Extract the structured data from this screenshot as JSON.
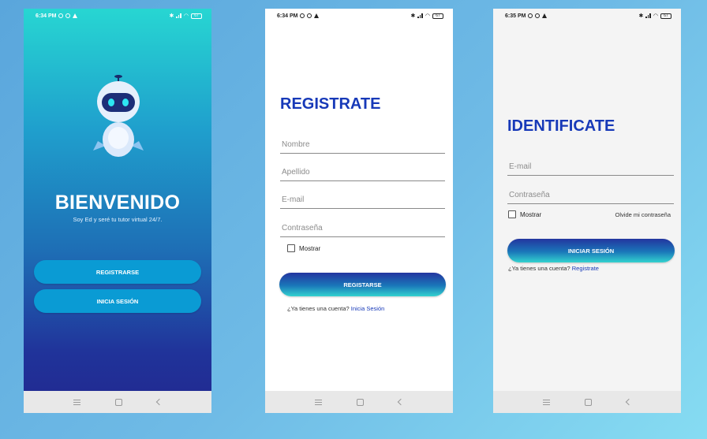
{
  "screens": {
    "welcome": {
      "status_time": "6:34 PM",
      "battery": "67",
      "title": "BIENVENIDO",
      "subtitle": "Soy Ed y seré tu tutor virtual 24/7.",
      "register_button": "REGISTRARSE",
      "login_button": "INICIA SESIÓN"
    },
    "register": {
      "status_time": "6:34 PM",
      "battery": "67",
      "title": "REGISTRATE",
      "name_placeholder": "Nombre",
      "lastname_placeholder": "Apellido",
      "email_placeholder": "E-mail",
      "password_placeholder": "Contraseña",
      "show_label": "Mostrar",
      "submit_button": "REGISTARSE",
      "account_prompt": "¿Ya tienes una cuenta?",
      "account_link": "Inicia Sesión"
    },
    "login": {
      "status_time": "6:35 PM",
      "battery": "67",
      "title": "IDENTIFICATE",
      "email_placeholder": "E-mail",
      "password_placeholder": "Contraseña",
      "show_label": "Mostrar",
      "forgot_link": "Olvide mi contraseña",
      "submit_button": "INICIAR SESIÓN",
      "account_prompt": "¿Ya tienes una cuenta?",
      "account_link": "Registrate"
    }
  },
  "colors": {
    "accent_blue": "#1739b8",
    "pill_blue": "#0a9bd4",
    "teal": "#27d6d2",
    "navy": "#22288f"
  },
  "icons": [
    "alarm-icon",
    "settings-icon",
    "warning-icon",
    "bluetooth-icon",
    "signal-icon",
    "wifi-icon",
    "battery-icon",
    "menu-icon",
    "home-icon",
    "back-icon",
    "robot-mascot"
  ]
}
